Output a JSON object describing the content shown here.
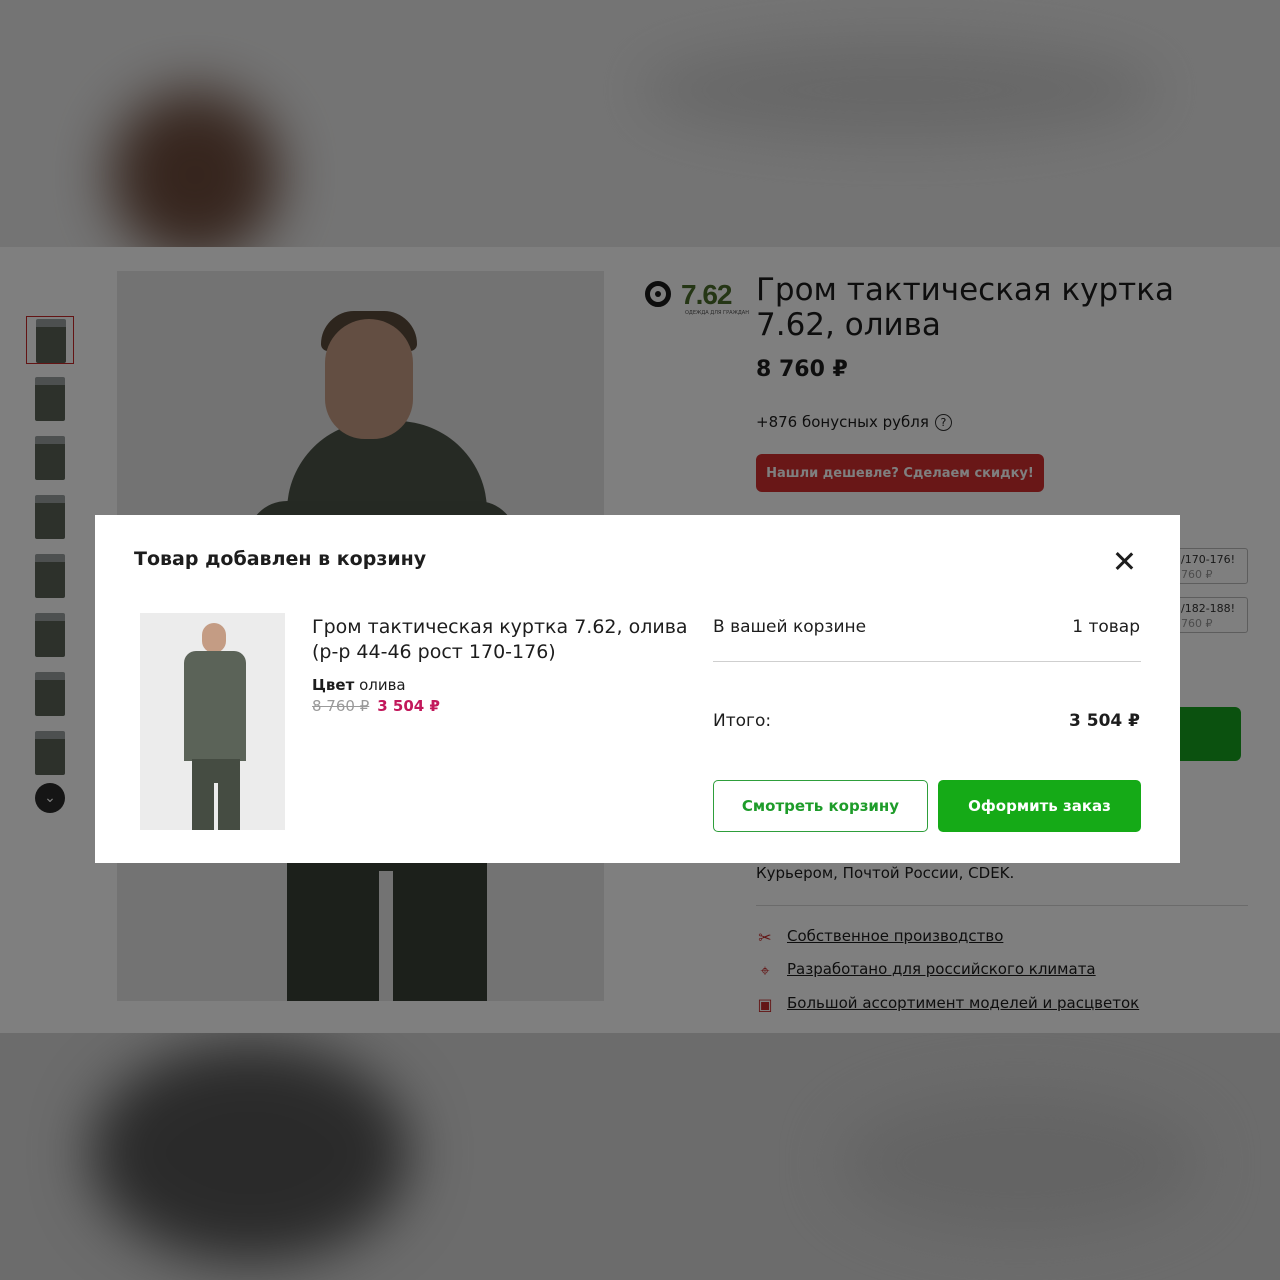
{
  "product": {
    "brand_logo_text": "7.62",
    "title": "Гром тактическая куртка 7.62, олива",
    "price": "8 760 ₽",
    "bonus": "+876 бонусных рубля",
    "cheaper_button": "Нашли дешевле? Сделаем скидку!",
    "size_options": [
      {
        "label": "/170-176!",
        "price": "760 ₽"
      },
      {
        "label": "/182-188!",
        "price": "760 ₽"
      }
    ],
    "delivery": "Курьером, Почтой России, CDEK.",
    "features": [
      {
        "icon": "scissors-icon",
        "label": "Собственное производство"
      },
      {
        "icon": "target-icon",
        "label": "Разработано для российского климата"
      },
      {
        "icon": "shirt-icon",
        "label": "Большой ассортимент моделей и расцветок"
      }
    ]
  },
  "modal": {
    "title": "Товар добавлен в корзину",
    "item": {
      "name": "Гром тактическая куртка 7.62, олива (р-р 44-46 рост 170-176)",
      "color_label": "Цвет",
      "color_value": "олива",
      "old_price": "8 760 ₽",
      "new_price": "3 504 ₽"
    },
    "cart_label": "В вашей корзине",
    "cart_count": "1 товар",
    "total_label": "Итого:",
    "total_value": "3 504 ₽",
    "view_cart_button": "Смотреть корзину",
    "checkout_button": "Оформить заказ"
  },
  "colors": {
    "accent_green": "#15aa17",
    "discount_red": "#c2185b",
    "promo_red": "#d32f2f"
  }
}
